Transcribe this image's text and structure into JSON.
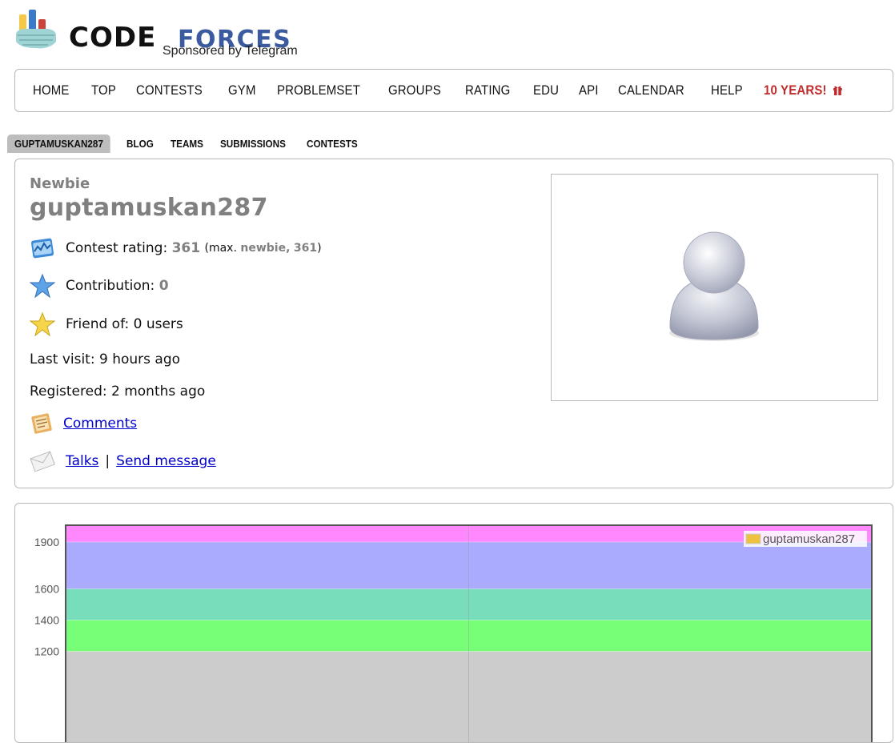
{
  "logo": {
    "code": "CODE",
    "forces": "FORCES",
    "sponsor": "Sponsored by Telegram"
  },
  "menu": {
    "items": [
      "HOME",
      "TOP",
      "CONTESTS",
      "GYM",
      "PROBLEMSET",
      "GROUPS",
      "RATING",
      "EDU",
      "API",
      "CALENDAR",
      "HELP"
    ],
    "special": "10 YEARS!",
    "special_color": "#c12b2b"
  },
  "submenu": {
    "items": [
      "GUPTAMUSKAN287",
      "BLOG",
      "TEAMS",
      "SUBMISSIONS",
      "CONTESTS"
    ],
    "active_index": 0
  },
  "profile": {
    "rank": "Newbie",
    "handle": "guptamuskan287",
    "rating_label": "Contest rating:",
    "rating": "361",
    "max_open": "(max.",
    "max_rank": "newbie,",
    "max_rating": "361",
    "max_close": ")",
    "contribution_label": "Contribution:",
    "contribution": "0",
    "friend_label": "Friend of: 0 users",
    "last_visit": "Last visit: 9 hours ago",
    "registered": "Registered: 2 months ago",
    "comments": "Comments",
    "talks": "Talks",
    "separator": "|",
    "send_message": "Send message",
    "rank_color": "#808080"
  },
  "chart_data": {
    "type": "line",
    "y_ticks": [
      1200,
      1400,
      1600,
      1900
    ],
    "ylim": [
      800,
      2000
    ],
    "bands": [
      {
        "from": 0,
        "to": 1200,
        "color": "#cccccc"
      },
      {
        "from": 1200,
        "to": 1400,
        "color": "#77ff77"
      },
      {
        "from": 1400,
        "to": 1600,
        "color": "#77ddbb"
      },
      {
        "from": 1600,
        "to": 1900,
        "color": "#aaaaff"
      },
      {
        "from": 1900,
        "to": 2100,
        "color": "#ff88ff"
      }
    ],
    "series": [
      {
        "name": "guptamuskan287",
        "color": "#edc240",
        "values": []
      }
    ],
    "legend": "top-right",
    "grid": true
  }
}
